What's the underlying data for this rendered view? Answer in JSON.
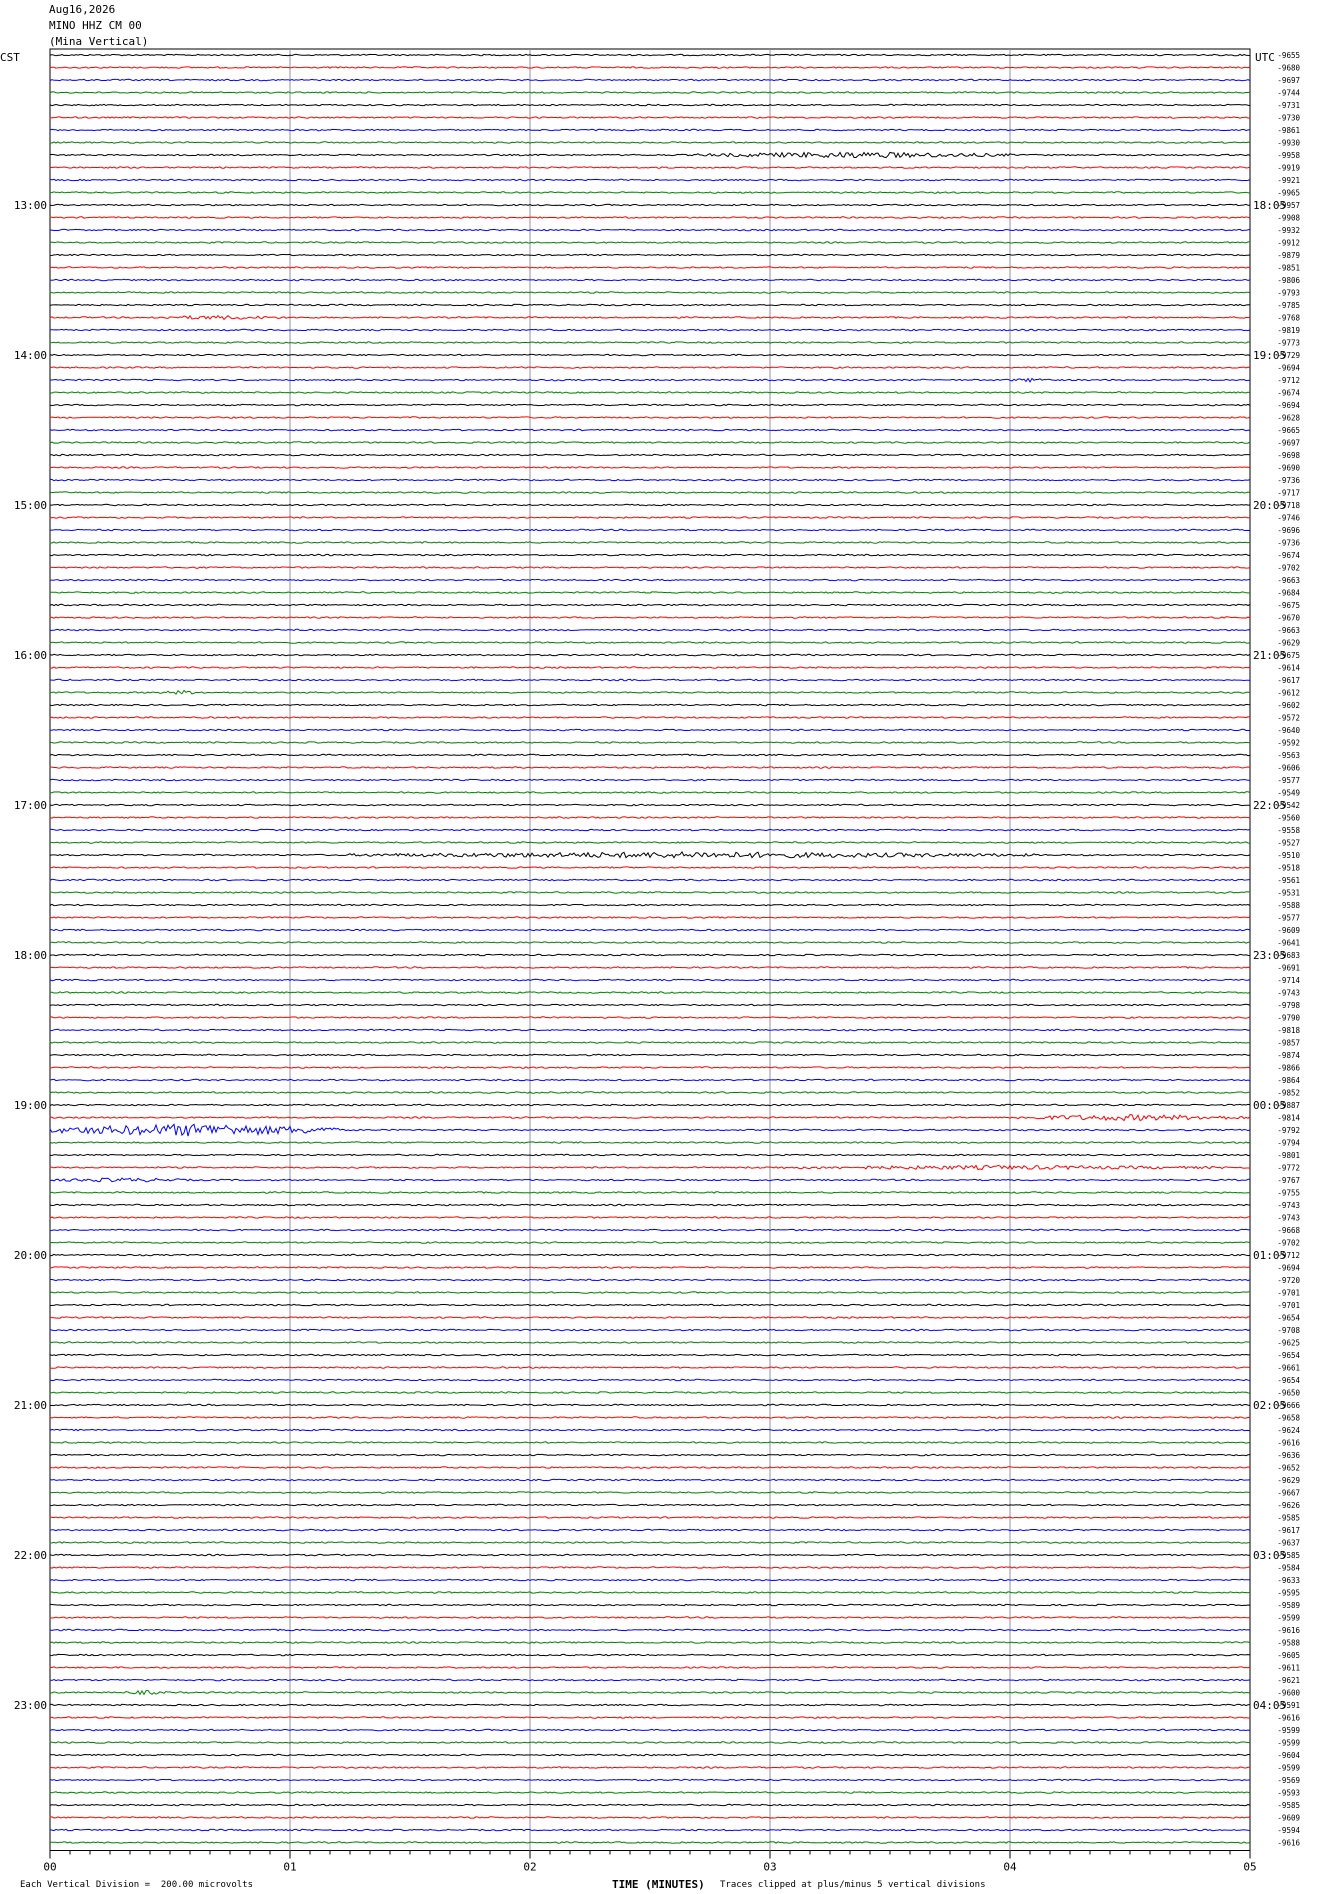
{
  "header": {
    "date": "Aug16,2026",
    "station": "MINO HHZ CM 00",
    "location": "(Mina Vertical)"
  },
  "left_zone_label": "CST",
  "right_zone_label": "UTC",
  "footer": {
    "scale_note": "Each Vertical Division =  200.00 microvolts",
    "x_axis_title": "TIME (MINUTES)",
    "clip_note": "Traces clipped at plus/minus 5 vertical divisions"
  },
  "chart_data": {
    "type": "line",
    "title": "MINO HHZ CM 00 (Mina Vertical) Aug16,2026",
    "xlabel": "TIME (MINUTES)",
    "x_range": [
      0,
      5
    ],
    "x_ticks": [
      "00",
      "01",
      "02",
      "03",
      "04",
      "05"
    ],
    "trace_count": 144,
    "trace_colors": [
      "#000000",
      "#ff0000",
      "#0000ff",
      "#008000"
    ],
    "left_hour_labels": [
      {
        "trace": 12,
        "text": "13:00"
      },
      {
        "trace": 24,
        "text": "14:00"
      },
      {
        "trace": 36,
        "text": "15:00"
      },
      {
        "trace": 48,
        "text": "16:00"
      },
      {
        "trace": 60,
        "text": "17:00"
      },
      {
        "trace": 72,
        "text": "18:00"
      },
      {
        "trace": 84,
        "text": "19:00"
      },
      {
        "trace": 96,
        "text": "20:00"
      },
      {
        "trace": 108,
        "text": "21:00"
      },
      {
        "trace": 120,
        "text": "22:00"
      },
      {
        "trace": 132,
        "text": "23:00"
      }
    ],
    "right_hour_labels": [
      {
        "trace": 12,
        "text": "18:05"
      },
      {
        "trace": 24,
        "text": "19:05"
      },
      {
        "trace": 36,
        "text": "20:05"
      },
      {
        "trace": 48,
        "text": "21:05"
      },
      {
        "trace": 60,
        "text": "22:05"
      },
      {
        "trace": 72,
        "text": "23:05"
      },
      {
        "trace": 84,
        "text": "00:05"
      },
      {
        "trace": 96,
        "text": "01:05"
      },
      {
        "trace": 108,
        "text": "02:05"
      },
      {
        "trace": 120,
        "text": "03:05"
      },
      {
        "trace": 132,
        "text": "04:05"
      }
    ],
    "trace_offsets": [
      -9655,
      -9680,
      -9697,
      -9744,
      -9731,
      -9730,
      -9861,
      -9930,
      -9958,
      -9919,
      -9921,
      -9965,
      -9957,
      -9908,
      -9932,
      -9912,
      -9879,
      -9851,
      -9806,
      -9793,
      -9785,
      -9768,
      -9819,
      -9773,
      -9729,
      -9694,
      -9712,
      -9674,
      -9694,
      -9628,
      -9665,
      -9697,
      -9698,
      -9690,
      -9736,
      -9717,
      -9718,
      -9746,
      -9696,
      -9736,
      -9674,
      -9702,
      -9663,
      -9684,
      -9675,
      -9670,
      -9663,
      -9629,
      -9675,
      -9614,
      -9617,
      -9612,
      -9602,
      -9572,
      -9640,
      -9592,
      -9563,
      -9606,
      -9577,
      -9549,
      -9542,
      -9560,
      -9558,
      -9527,
      -9510,
      -9518,
      -9561,
      -9531,
      -9588,
      -9577,
      -9609,
      -9641,
      -9683,
      -9691,
      -9714,
      -9743,
      -9798,
      -9790,
      -9818,
      -9857,
      -9874,
      -9866,
      -9864,
      -9852,
      -9887,
      -9814,
      -9792,
      -9794,
      -9801,
      -9772,
      -9767,
      -9755,
      -9743,
      -9743,
      -9668,
      -9702,
      -9712,
      -9694,
      -9720,
      -9701,
      -9701,
      -9654,
      -9708,
      -9625,
      -9654,
      -9661,
      -9654,
      -9650,
      -9666,
      -9658,
      -9624,
      -9616,
      -9636,
      -9652,
      -9629,
      -9667,
      -9626,
      -9585,
      -9617,
      -9637,
      -9585,
      -9584,
      -9633,
      -9595,
      -9589,
      -9599,
      -9616,
      -9588,
      -9605,
      -9611,
      -9621,
      -9600,
      -9591,
      -9616,
      -9599,
      -9599,
      -9604,
      -9599,
      -9569,
      -9593,
      -9585,
      -9609,
      -9594,
      -9616
    ],
    "events": [
      {
        "trace": 8,
        "x_start": 2.7,
        "x_end": 4.0,
        "level": "moderate"
      },
      {
        "trace": 21,
        "x_start": 0.4,
        "x_end": 1.0,
        "level": "small"
      },
      {
        "trace": 26,
        "x_start": 4.0,
        "x_end": 4.2,
        "level": "small"
      },
      {
        "trace": 51,
        "x_start": 0.45,
        "x_end": 0.65,
        "level": "small"
      },
      {
        "trace": 64,
        "x_start": 1.25,
        "x_end": 4.1,
        "level": "moderate"
      },
      {
        "trace": 85,
        "x_start": 4.0,
        "x_end": 5.0,
        "level": "moderate"
      },
      {
        "trace": 86,
        "x_start": 0.0,
        "x_end": 1.2,
        "level": "large"
      },
      {
        "trace": 89,
        "x_start": 2.9,
        "x_end": 5.0,
        "level": "small"
      },
      {
        "trace": 90,
        "x_start": 0.0,
        "x_end": 0.6,
        "level": "small"
      },
      {
        "trace": 131,
        "x_start": 0.3,
        "x_end": 0.5,
        "level": "small"
      }
    ]
  }
}
